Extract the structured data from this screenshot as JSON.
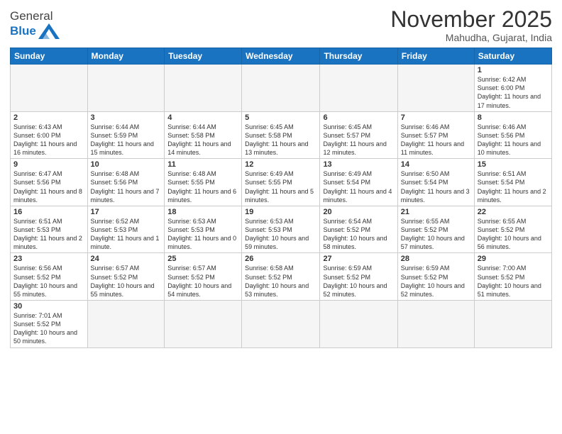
{
  "logo": {
    "text_general": "General",
    "text_blue": "Blue"
  },
  "title": "November 2025",
  "location": "Mahudha, Gujarat, India",
  "days_of_week": [
    "Sunday",
    "Monday",
    "Tuesday",
    "Wednesday",
    "Thursday",
    "Friday",
    "Saturday"
  ],
  "weeks": [
    [
      {
        "day": "",
        "info": ""
      },
      {
        "day": "",
        "info": ""
      },
      {
        "day": "",
        "info": ""
      },
      {
        "day": "",
        "info": ""
      },
      {
        "day": "",
        "info": ""
      },
      {
        "day": "",
        "info": ""
      },
      {
        "day": "1",
        "info": "Sunrise: 6:42 AM\nSunset: 6:00 PM\nDaylight: 11 hours and 17 minutes."
      }
    ],
    [
      {
        "day": "2",
        "info": "Sunrise: 6:43 AM\nSunset: 6:00 PM\nDaylight: 11 hours and 16 minutes."
      },
      {
        "day": "3",
        "info": "Sunrise: 6:44 AM\nSunset: 5:59 PM\nDaylight: 11 hours and 15 minutes."
      },
      {
        "day": "4",
        "info": "Sunrise: 6:44 AM\nSunset: 5:58 PM\nDaylight: 11 hours and 14 minutes."
      },
      {
        "day": "5",
        "info": "Sunrise: 6:45 AM\nSunset: 5:58 PM\nDaylight: 11 hours and 13 minutes."
      },
      {
        "day": "6",
        "info": "Sunrise: 6:45 AM\nSunset: 5:57 PM\nDaylight: 11 hours and 12 minutes."
      },
      {
        "day": "7",
        "info": "Sunrise: 6:46 AM\nSunset: 5:57 PM\nDaylight: 11 hours and 11 minutes."
      },
      {
        "day": "8",
        "info": "Sunrise: 6:46 AM\nSunset: 5:56 PM\nDaylight: 11 hours and 10 minutes."
      }
    ],
    [
      {
        "day": "9",
        "info": "Sunrise: 6:47 AM\nSunset: 5:56 PM\nDaylight: 11 hours and 8 minutes."
      },
      {
        "day": "10",
        "info": "Sunrise: 6:48 AM\nSunset: 5:56 PM\nDaylight: 11 hours and 7 minutes."
      },
      {
        "day": "11",
        "info": "Sunrise: 6:48 AM\nSunset: 5:55 PM\nDaylight: 11 hours and 6 minutes."
      },
      {
        "day": "12",
        "info": "Sunrise: 6:49 AM\nSunset: 5:55 PM\nDaylight: 11 hours and 5 minutes."
      },
      {
        "day": "13",
        "info": "Sunrise: 6:49 AM\nSunset: 5:54 PM\nDaylight: 11 hours and 4 minutes."
      },
      {
        "day": "14",
        "info": "Sunrise: 6:50 AM\nSunset: 5:54 PM\nDaylight: 11 hours and 3 minutes."
      },
      {
        "day": "15",
        "info": "Sunrise: 6:51 AM\nSunset: 5:54 PM\nDaylight: 11 hours and 2 minutes."
      }
    ],
    [
      {
        "day": "16",
        "info": "Sunrise: 6:51 AM\nSunset: 5:53 PM\nDaylight: 11 hours and 2 minutes."
      },
      {
        "day": "17",
        "info": "Sunrise: 6:52 AM\nSunset: 5:53 PM\nDaylight: 11 hours and 1 minute."
      },
      {
        "day": "18",
        "info": "Sunrise: 6:53 AM\nSunset: 5:53 PM\nDaylight: 11 hours and 0 minutes."
      },
      {
        "day": "19",
        "info": "Sunrise: 6:53 AM\nSunset: 5:53 PM\nDaylight: 10 hours and 59 minutes."
      },
      {
        "day": "20",
        "info": "Sunrise: 6:54 AM\nSunset: 5:52 PM\nDaylight: 10 hours and 58 minutes."
      },
      {
        "day": "21",
        "info": "Sunrise: 6:55 AM\nSunset: 5:52 PM\nDaylight: 10 hours and 57 minutes."
      },
      {
        "day": "22",
        "info": "Sunrise: 6:55 AM\nSunset: 5:52 PM\nDaylight: 10 hours and 56 minutes."
      }
    ],
    [
      {
        "day": "23",
        "info": "Sunrise: 6:56 AM\nSunset: 5:52 PM\nDaylight: 10 hours and 55 minutes."
      },
      {
        "day": "24",
        "info": "Sunrise: 6:57 AM\nSunset: 5:52 PM\nDaylight: 10 hours and 55 minutes."
      },
      {
        "day": "25",
        "info": "Sunrise: 6:57 AM\nSunset: 5:52 PM\nDaylight: 10 hours and 54 minutes."
      },
      {
        "day": "26",
        "info": "Sunrise: 6:58 AM\nSunset: 5:52 PM\nDaylight: 10 hours and 53 minutes."
      },
      {
        "day": "27",
        "info": "Sunrise: 6:59 AM\nSunset: 5:52 PM\nDaylight: 10 hours and 52 minutes."
      },
      {
        "day": "28",
        "info": "Sunrise: 6:59 AM\nSunset: 5:52 PM\nDaylight: 10 hours and 52 minutes."
      },
      {
        "day": "29",
        "info": "Sunrise: 7:00 AM\nSunset: 5:52 PM\nDaylight: 10 hours and 51 minutes."
      }
    ],
    [
      {
        "day": "30",
        "info": "Sunrise: 7:01 AM\nSunset: 5:52 PM\nDaylight: 10 hours and 50 minutes."
      },
      {
        "day": "",
        "info": ""
      },
      {
        "day": "",
        "info": ""
      },
      {
        "day": "",
        "info": ""
      },
      {
        "day": "",
        "info": ""
      },
      {
        "day": "",
        "info": ""
      },
      {
        "day": "",
        "info": ""
      }
    ]
  ]
}
